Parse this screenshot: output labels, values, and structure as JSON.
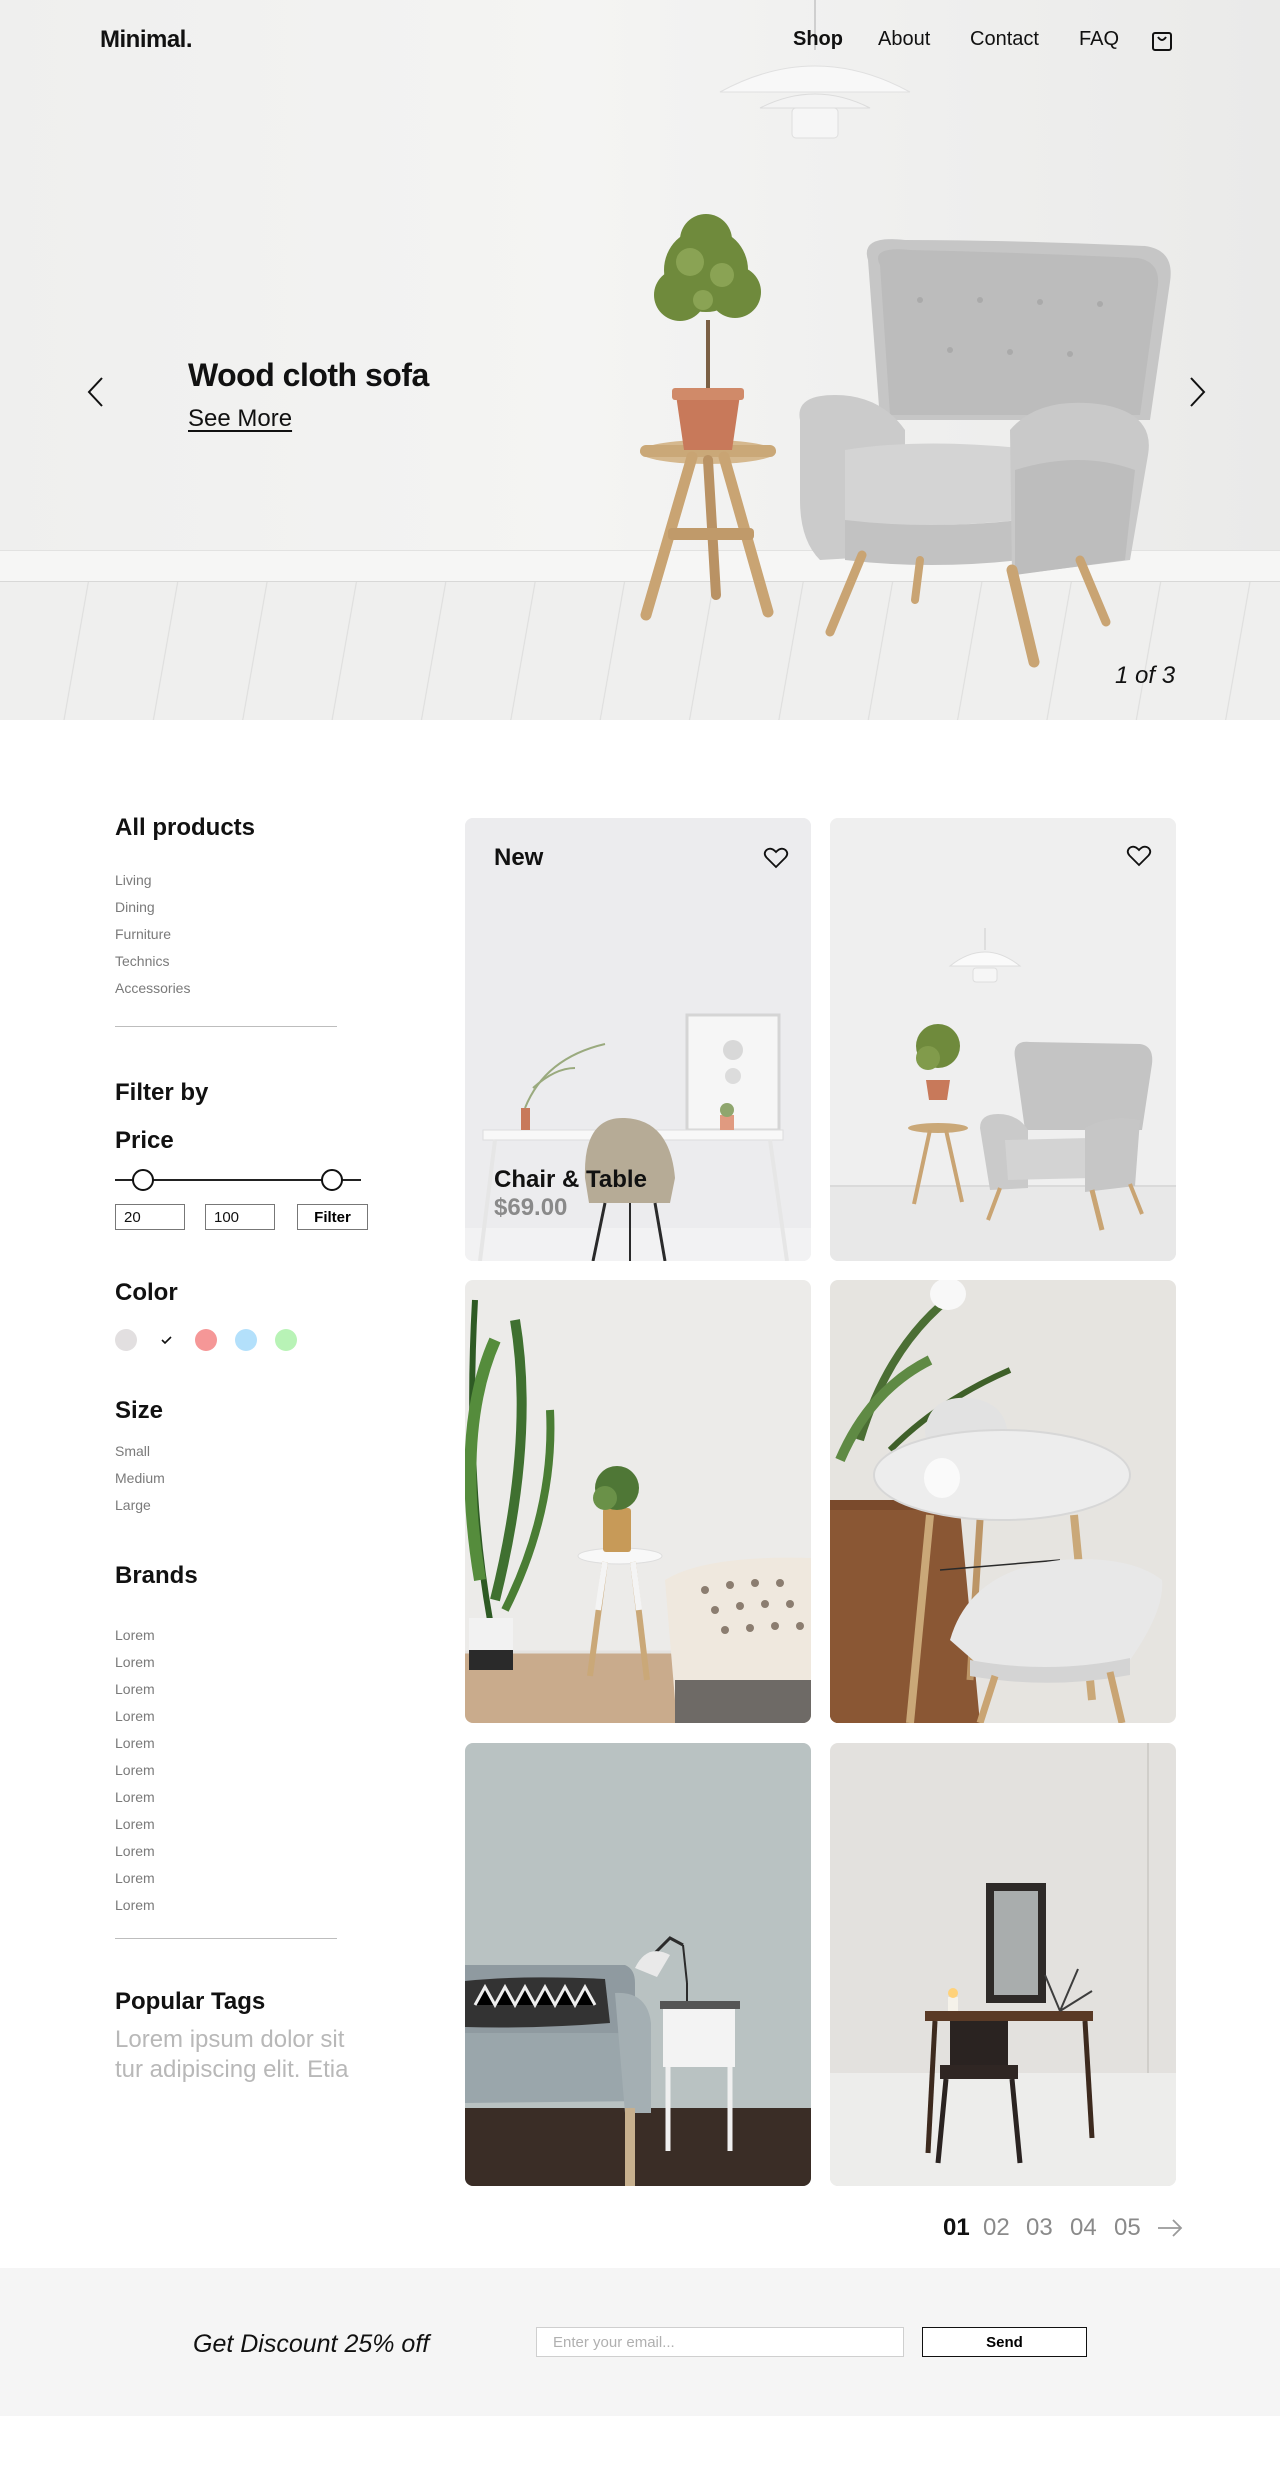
{
  "header": {
    "logo": "Minimal.",
    "nav": [
      {
        "label": "Shop",
        "active": true
      },
      {
        "label": "About",
        "active": false
      },
      {
        "label": "Contact",
        "active": false
      },
      {
        "label": "FAQ",
        "active": false
      }
    ],
    "cart_icon": "shopping-bag-icon"
  },
  "hero": {
    "title": "Wood cloth  sofa",
    "link": "See More",
    "counter": "1 of 3",
    "prev_icon": "chevron-left-icon",
    "next_icon": "chevron-right-icon"
  },
  "sidebar": {
    "all_products_title": "All products",
    "categories": [
      "Living",
      "Dining",
      "Furniture",
      "Technics",
      "Accessories"
    ],
    "filter_title": "Filter by",
    "price_title": "Price",
    "price_min": "20",
    "price_max": "100",
    "filter_button": "Filter",
    "color_title": "Color",
    "colors": [
      "#e2dfe0",
      "#ffffff",
      "#f59797",
      "#b3e0fb",
      "#b8f3b6"
    ],
    "selected_color_index": 1,
    "size_title": "Size",
    "sizes": [
      "Small",
      "Medium",
      "Large"
    ],
    "brands_title": "Brands",
    "brands": [
      "Lorem",
      "Lorem",
      "Lorem",
      "Lorem",
      "Lorem",
      "Lorem",
      "Lorem",
      "Lorem",
      "Lorem",
      "Lorem",
      "Lorem"
    ],
    "tags_title": "Popular  Tags",
    "tags_text_line1": "Lorem ipsum dolor sit",
    "tags_text_line2": "tur adipiscing elit. Etia"
  },
  "products": [
    {
      "badge": "New",
      "name": "Chair & Table",
      "price": "$69.00",
      "favorite_icon": "heart-icon"
    },
    {
      "favorite_icon": "heart-icon"
    },
    {},
    {},
    {},
    {}
  ],
  "pagination": {
    "pages": [
      "01",
      "02",
      "03",
      "04",
      "05"
    ],
    "active_index": 0,
    "next_icon": "arrow-right-icon"
  },
  "newsletter": {
    "text": "Get Discount 25% off",
    "email_placeholder": "Enter your email...",
    "button": "Send"
  },
  "colors": {
    "text": "#111111",
    "muted": "#8a8a8a",
    "footer_bg": "#f5f5f5"
  }
}
